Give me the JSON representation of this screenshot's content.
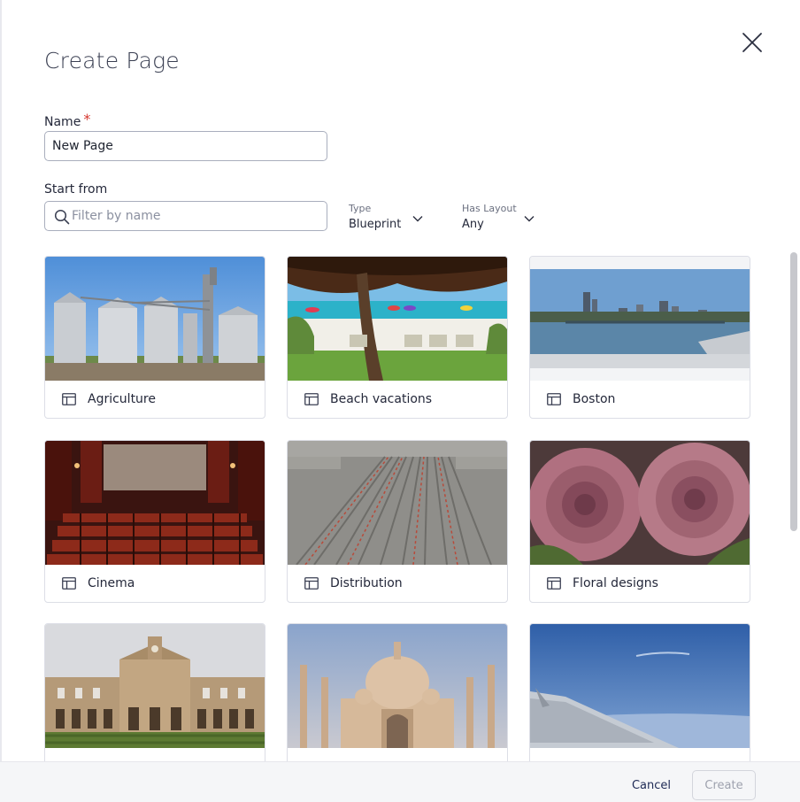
{
  "dialog": {
    "title": "Create Page",
    "close_icon": "close-icon"
  },
  "name_field": {
    "label": "Name",
    "required_mark": "*",
    "value": "New Page"
  },
  "start_from": {
    "label": "Start from",
    "filter_placeholder": "Filter by name",
    "type_filter": {
      "label": "Type",
      "value": "Blueprint"
    },
    "layout_filter": {
      "label": "Has Layout",
      "value": "Any"
    }
  },
  "templates": [
    {
      "name": "Agriculture",
      "icon": "template-icon"
    },
    {
      "name": "Beach vacations",
      "icon": "template-icon"
    },
    {
      "name": "Boston",
      "icon": "template-icon"
    },
    {
      "name": "Cinema",
      "icon": "template-icon"
    },
    {
      "name": "Distribution",
      "icon": "template-icon"
    },
    {
      "name": "Floral designs",
      "icon": "template-icon"
    },
    {
      "name": "",
      "icon": "template-icon"
    },
    {
      "name": "",
      "icon": "template-icon"
    },
    {
      "name": "",
      "icon": "template-icon"
    }
  ],
  "footer": {
    "cancel_label": "Cancel",
    "create_label": "Create"
  },
  "colors": {
    "accent_text": "#1e2a55",
    "required": "#d6372f",
    "disabled_text": "#9ea2ae"
  }
}
